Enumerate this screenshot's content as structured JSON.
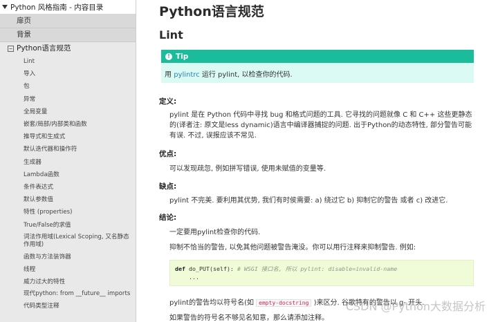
{
  "sidebar": {
    "header_title": "Python 风格指南 - 内容目录",
    "top_items": [
      "扉页",
      "背景"
    ],
    "section": {
      "toggle": "−",
      "label": "Python语言规范"
    },
    "items": [
      "Lint",
      "导入",
      "包",
      "异常",
      "全局变量",
      "嵌套/局部/内部类和函数",
      "推导式和生成式",
      "默认迭代器和操作符",
      "生成器",
      "Lambda函数",
      "条件表达式",
      "默认参数值",
      "特性 (properties)",
      "True/False的求值",
      "词法作用域(Lexical Scoping, 又名静态作用域)",
      "函数与方法装饰器",
      "线程",
      "威力过大的特性",
      "现代python: from __future__ imports",
      "代码类型注释"
    ]
  },
  "main": {
    "title": "Python语言规范",
    "subtitle": "Lint",
    "tip": {
      "icon": "!",
      "title": "Tip",
      "text_before": "用 ",
      "link": "pylintrc",
      "text_after": " 运行 pylint, 以检查你的代码."
    },
    "definition_label": "定义:",
    "definition_text": "pylint 是在 Python 代码中寻找 bug 和格式问题的工具. 它寻找的问题就像 C 和 C++ 这些更静态的(译者注: 原文是less dynamic)语言中编译器捕捉的问题. 出于Python的动态特性, 部分警告可能有误. 不过, 误报应该不常见.",
    "pros_label": "优点:",
    "pros_text": "可以发现疏忽, 例如拼写错误, 使用未赋值的变量等.",
    "cons_label": "缺点:",
    "cons_text": "pylint 不完美. 要利用其优势, 我们有时侯需要: a) 绕过它 b) 抑制它的警告 或者 c) 改进它.",
    "conclusion_label": "结论:",
    "conclusion_text1": "一定要用pylint检查你的代码.",
    "conclusion_text2": "抑制不恰当的警告, 以免其他问题被警告淹没。你可以用行注释来抑制警告. 例如:",
    "code": {
      "kw": "def",
      "sig": " do_PUT(self):",
      "comment": "  # WSGI 接口名, 所以 pylint: disable=invalid-name",
      "line2": "    ..."
    },
    "after_code_before": "pylint的警告均以符号名(如 ",
    "after_code_code": "empty-docstring",
    "after_code_after": " )来区分. 谷歌特有的警告以 g- 开头.",
    "last_line": "如果警告的符号名不够见名知意，那么请添加注释。",
    "watermark": "CSDN @Python大数据分析"
  }
}
